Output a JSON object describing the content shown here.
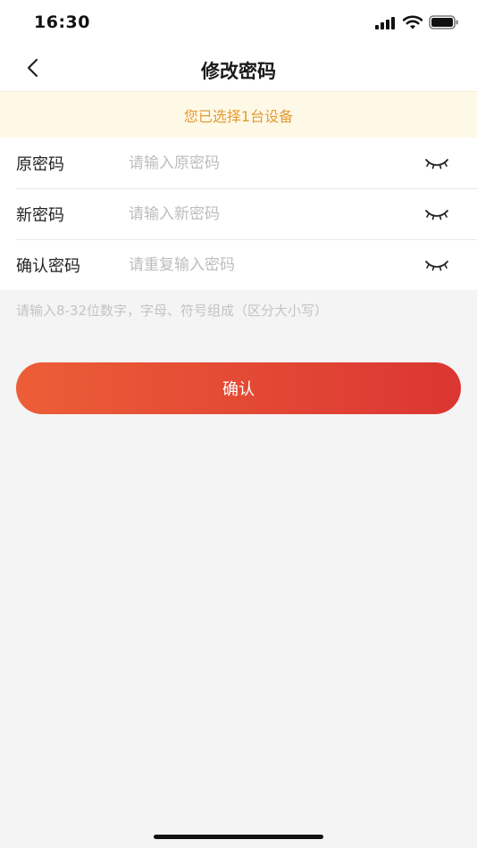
{
  "status_bar": {
    "time": "16:30"
  },
  "nav": {
    "title": "修改密码"
  },
  "notice": {
    "text": "您已选择1台设备"
  },
  "form": {
    "rows": [
      {
        "label": "原密码",
        "placeholder": "请输入原密码"
      },
      {
        "label": "新密码",
        "placeholder": "请输入新密码"
      },
      {
        "label": "确认密码",
        "placeholder": "请重复输入密码"
      }
    ]
  },
  "hint": "请输入8-32位数字，字母、符号组成（区分大小写）",
  "confirm_label": "确认",
  "colors": {
    "accent_start": "#ec5e37",
    "accent_end": "#db3632",
    "notice_bg": "#fef9e6",
    "notice_text": "#e39a35"
  },
  "icons": [
    "signal-icon",
    "wifi-icon",
    "battery-icon",
    "back-arrow-icon",
    "eye-closed-icon"
  ]
}
